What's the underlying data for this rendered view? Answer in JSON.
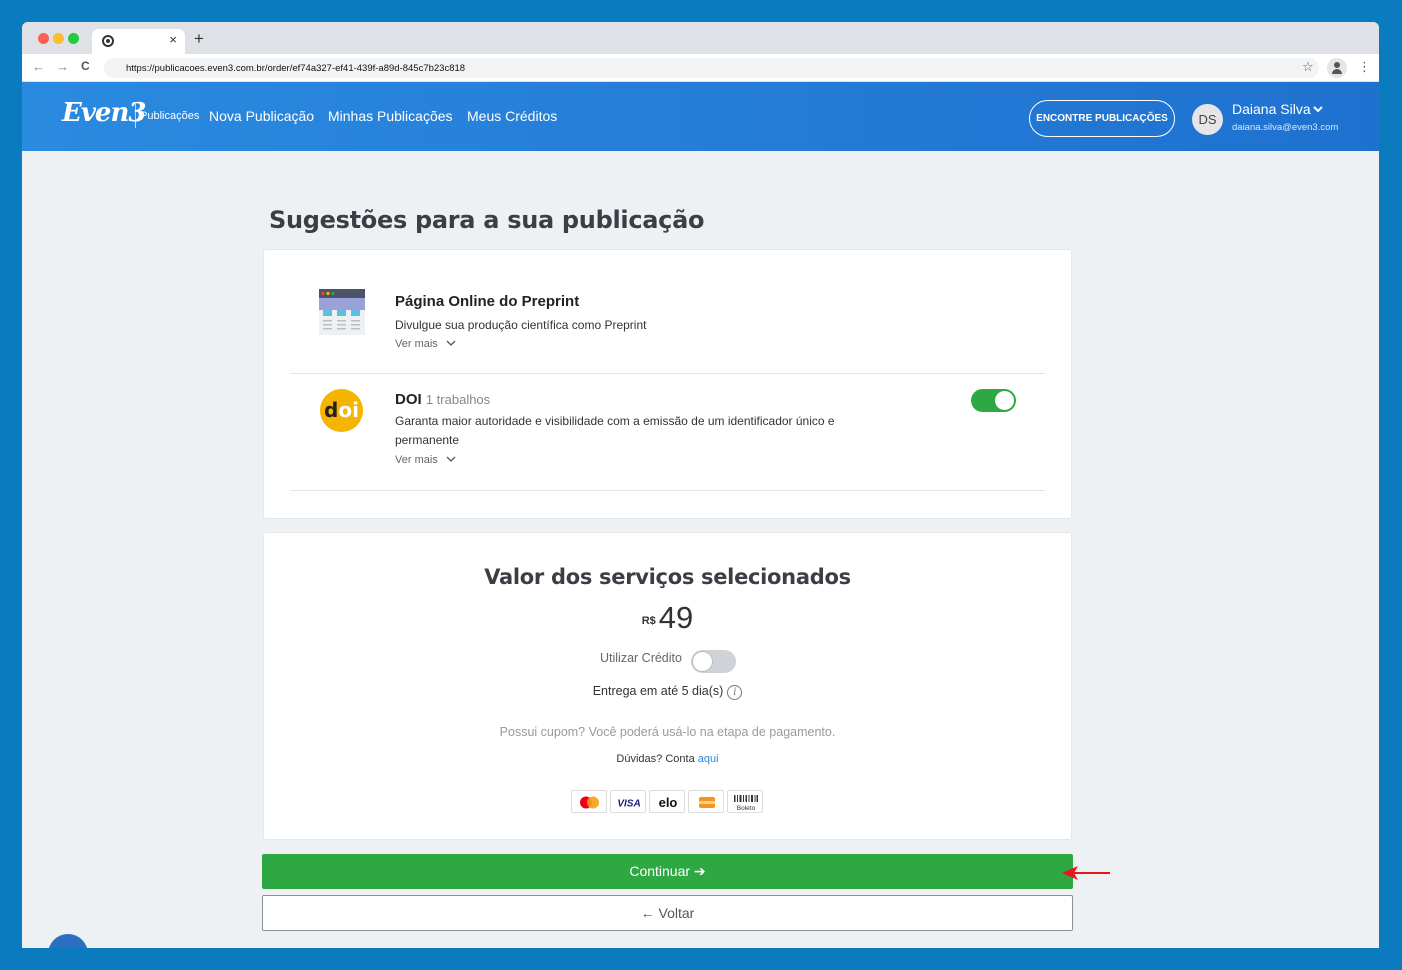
{
  "browser": {
    "tab_close": "×",
    "new_tab": "+",
    "back": "←",
    "forward": "→",
    "reload": "C",
    "url": "https://publicacoes.even3.com.br/order/ef74a327-ef41-439f-a89d-845c7b23c818",
    "bookmark_icon": "☆",
    "menu_icon": "⋮",
    "traffic_colors": [
      "#ff5f57",
      "#febc2e",
      "#28c840"
    ]
  },
  "header": {
    "logo": "Even3",
    "sub_brand": "Publicações",
    "nav": [
      "Nova Publicação",
      "Minhas Publicações",
      "Meus Créditos"
    ],
    "find_button": "ENCONTRE PUBLICAÇÕES",
    "user_initials": "DS",
    "user_name": "Daiana Silva",
    "user_email": "daiana.silva@even3.com"
  },
  "page": {
    "title": "Sugestões para a sua publicação"
  },
  "suggestions": [
    {
      "title": "Página Online do Preprint",
      "count": "",
      "description": "Divulgue sua produção científica como Preprint",
      "more": "Ver mais",
      "icon": "preprint-page-icon",
      "has_toggle": false
    },
    {
      "title": "DOI",
      "count": "1 trabalhos",
      "description": "Garanta maior autoridade e visibilidade com a emissão de um identificador único e permanente",
      "more": "Ver mais",
      "icon": "doi-icon",
      "has_toggle": true,
      "enabled": true
    }
  ],
  "price_card": {
    "title": "Valor dos serviços selecionados",
    "currency": "R$",
    "amount": "49",
    "credit_label": "Utilizar Crédito",
    "credit_enabled": false,
    "delivery": "Entrega em até 5 dia(s)",
    "coupon": "Possui cupom? Você poderá usá-lo na etapa de pagamento.",
    "doubts": "Dúvidas? Conta",
    "doubts_link": "aqui",
    "payment_methods": [
      "mastercard",
      "VISA",
      "elo",
      "hipercard",
      "Boleto"
    ]
  },
  "actions": {
    "continue": "Continuar ➔",
    "back": "← Voltar"
  },
  "colors": {
    "brand_blue": "#2a8ae0",
    "success_green": "#2ea843",
    "background": "#0b7bbf"
  }
}
